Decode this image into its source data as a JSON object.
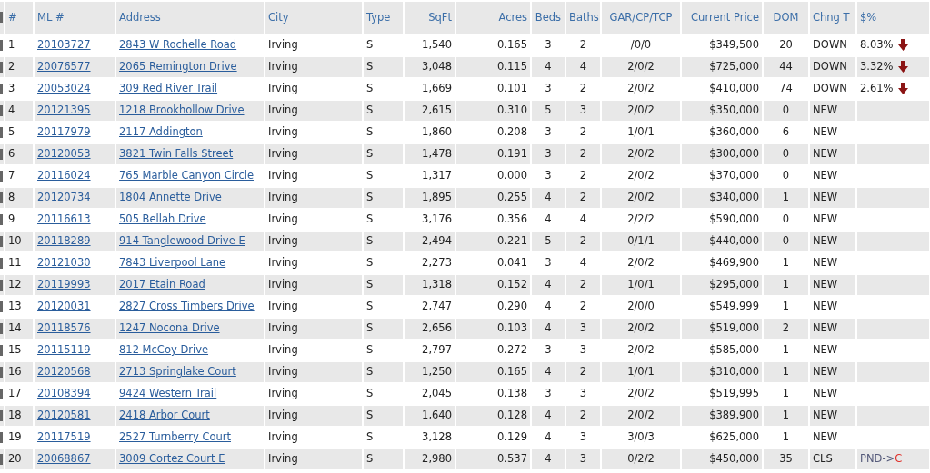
{
  "table": {
    "columns": [
      "#",
      "ML #",
      "Address",
      "City",
      "Type",
      "SqFt",
      "Acres",
      "Beds",
      "Baths",
      "GAR/CP/TCP",
      "Current Price",
      "DOM",
      "Chng T",
      "$%"
    ],
    "rows": [
      {
        "num": "1",
        "ml": "20103727",
        "address": "2843 W Rochelle Road",
        "city": "Irving",
        "type": "S",
        "sqft": "1,540",
        "acres": "0.165",
        "beds": "3",
        "baths": "2",
        "gar": "/0/0",
        "price": "$349,500",
        "dom": "20",
        "change": "DOWN",
        "pct": "8.03%",
        "price_drop": true
      },
      {
        "num": "2",
        "ml": "20076577",
        "address": "2065 Remington Drive",
        "city": "Irving",
        "type": "S",
        "sqft": "3,048",
        "acres": "0.115",
        "beds": "4",
        "baths": "4",
        "gar": "2/0/2",
        "price": "$725,000",
        "dom": "44",
        "change": "DOWN",
        "pct": "3.32%",
        "price_drop": true
      },
      {
        "num": "3",
        "ml": "20053024",
        "address": "309 Red River Trail",
        "city": "Irving",
        "type": "S",
        "sqft": "1,669",
        "acres": "0.101",
        "beds": "3",
        "baths": "2",
        "gar": "2/0/2",
        "price": "$410,000",
        "dom": "74",
        "change": "DOWN",
        "pct": "2.61%",
        "price_drop": true
      },
      {
        "num": "4",
        "ml": "20121395",
        "address": "1218 Brookhollow Drive",
        "city": "Irving",
        "type": "S",
        "sqft": "2,615",
        "acres": "0.310",
        "beds": "5",
        "baths": "3",
        "gar": "2/0/2",
        "price": "$350,000",
        "dom": "0",
        "change": "NEW"
      },
      {
        "num": "5",
        "ml": "20117979",
        "address": "2117 Addington",
        "city": "Irving",
        "type": "S",
        "sqft": "1,860",
        "acres": "0.208",
        "beds": "3",
        "baths": "2",
        "gar": "1/0/1",
        "price": "$360,000",
        "dom": "6",
        "change": "NEW"
      },
      {
        "num": "6",
        "ml": "20120053",
        "address": "3821 Twin Falls Street",
        "city": "Irving",
        "type": "S",
        "sqft": "1,478",
        "acres": "0.191",
        "beds": "3",
        "baths": "2",
        "gar": "2/0/2",
        "price": "$300,000",
        "dom": "0",
        "change": "NEW"
      },
      {
        "num": "7",
        "ml": "20116024",
        "address": "765 Marble Canyon Circle",
        "city": "Irving",
        "type": "S",
        "sqft": "1,317",
        "acres": "0.000",
        "beds": "3",
        "baths": "2",
        "gar": "2/0/2",
        "price": "$370,000",
        "dom": "0",
        "change": "NEW"
      },
      {
        "num": "8",
        "ml": "20120734",
        "address": "1804 Annette Drive",
        "city": "Irving",
        "type": "S",
        "sqft": "1,895",
        "acres": "0.255",
        "beds": "4",
        "baths": "2",
        "gar": "2/0/2",
        "price": "$340,000",
        "dom": "1",
        "change": "NEW"
      },
      {
        "num": "9",
        "ml": "20116613",
        "address": "505 Bellah Drive",
        "city": "Irving",
        "type": "S",
        "sqft": "3,176",
        "acres": "0.356",
        "beds": "4",
        "baths": "4",
        "gar": "2/2/2",
        "price": "$590,000",
        "dom": "0",
        "change": "NEW"
      },
      {
        "num": "10",
        "ml": "20118289",
        "address": "914 Tanglewood Drive E",
        "city": "Irving",
        "type": "S",
        "sqft": "2,494",
        "acres": "0.221",
        "beds": "5",
        "baths": "2",
        "gar": "0/1/1",
        "price": "$440,000",
        "dom": "0",
        "change": "NEW"
      },
      {
        "num": "11",
        "ml": "20121030",
        "address": "7843 Liverpool Lane",
        "city": "Irving",
        "type": "S",
        "sqft": "2,273",
        "acres": "0.041",
        "beds": "3",
        "baths": "4",
        "gar": "2/0/2",
        "price": "$469,900",
        "dom": "1",
        "change": "NEW"
      },
      {
        "num": "12",
        "ml": "20119993",
        "address": "2017 Etain Road",
        "city": "Irving",
        "type": "S",
        "sqft": "1,318",
        "acres": "0.152",
        "beds": "4",
        "baths": "2",
        "gar": "1/0/1",
        "price": "$295,000",
        "dom": "1",
        "change": "NEW"
      },
      {
        "num": "13",
        "ml": "20120031",
        "address": "2827 Cross Timbers Drive",
        "city": "Irving",
        "type": "S",
        "sqft": "2,747",
        "acres": "0.290",
        "beds": "4",
        "baths": "2",
        "gar": "2/0/0",
        "price": "$549,999",
        "dom": "1",
        "change": "NEW"
      },
      {
        "num": "14",
        "ml": "20118576",
        "address": "1247 Nocona Drive",
        "city": "Irving",
        "type": "S",
        "sqft": "2,656",
        "acres": "0.103",
        "beds": "4",
        "baths": "3",
        "gar": "2/0/2",
        "price": "$519,000",
        "dom": "2",
        "change": "NEW"
      },
      {
        "num": "15",
        "ml": "20115119",
        "address": "812 McCoy Drive",
        "city": "Irving",
        "type": "S",
        "sqft": "2,797",
        "acres": "0.272",
        "beds": "3",
        "baths": "3",
        "gar": "2/0/2",
        "price": "$585,000",
        "dom": "1",
        "change": "NEW"
      },
      {
        "num": "16",
        "ml": "20120568",
        "address": "2713 Springlake Court",
        "city": "Irving",
        "type": "S",
        "sqft": "1,250",
        "acres": "0.165",
        "beds": "4",
        "baths": "2",
        "gar": "1/0/1",
        "price": "$310,000",
        "dom": "1",
        "change": "NEW"
      },
      {
        "num": "17",
        "ml": "20108394",
        "address": "9424 Western Trail",
        "city": "Irving",
        "type": "S",
        "sqft": "2,045",
        "acres": "0.138",
        "beds": "3",
        "baths": "3",
        "gar": "2/0/2",
        "price": "$519,995",
        "dom": "1",
        "change": "NEW"
      },
      {
        "num": "18",
        "ml": "20120581",
        "address": "2418 Arbor Court",
        "city": "Irving",
        "type": "S",
        "sqft": "1,640",
        "acres": "0.128",
        "beds": "4",
        "baths": "2",
        "gar": "2/0/2",
        "price": "$389,900",
        "dom": "1",
        "change": "NEW"
      },
      {
        "num": "19",
        "ml": "20117519",
        "address": "2527 Turnberry Court",
        "city": "Irving",
        "type": "S",
        "sqft": "3,128",
        "acres": "0.129",
        "beds": "4",
        "baths": "3",
        "gar": "3/0/3",
        "price": "$625,000",
        "dom": "1",
        "change": "NEW"
      },
      {
        "num": "20",
        "ml": "20068867",
        "address": "3009 Cortez Court E",
        "city": "Irving",
        "type": "S",
        "sqft": "2,980",
        "acres": "0.537",
        "beds": "4",
        "baths": "3",
        "gar": "0/2/2",
        "price": "$450,000",
        "dom": "35",
        "change": "CLS",
        "status_from": "PND->",
        "status_to": "C"
      }
    ]
  }
}
